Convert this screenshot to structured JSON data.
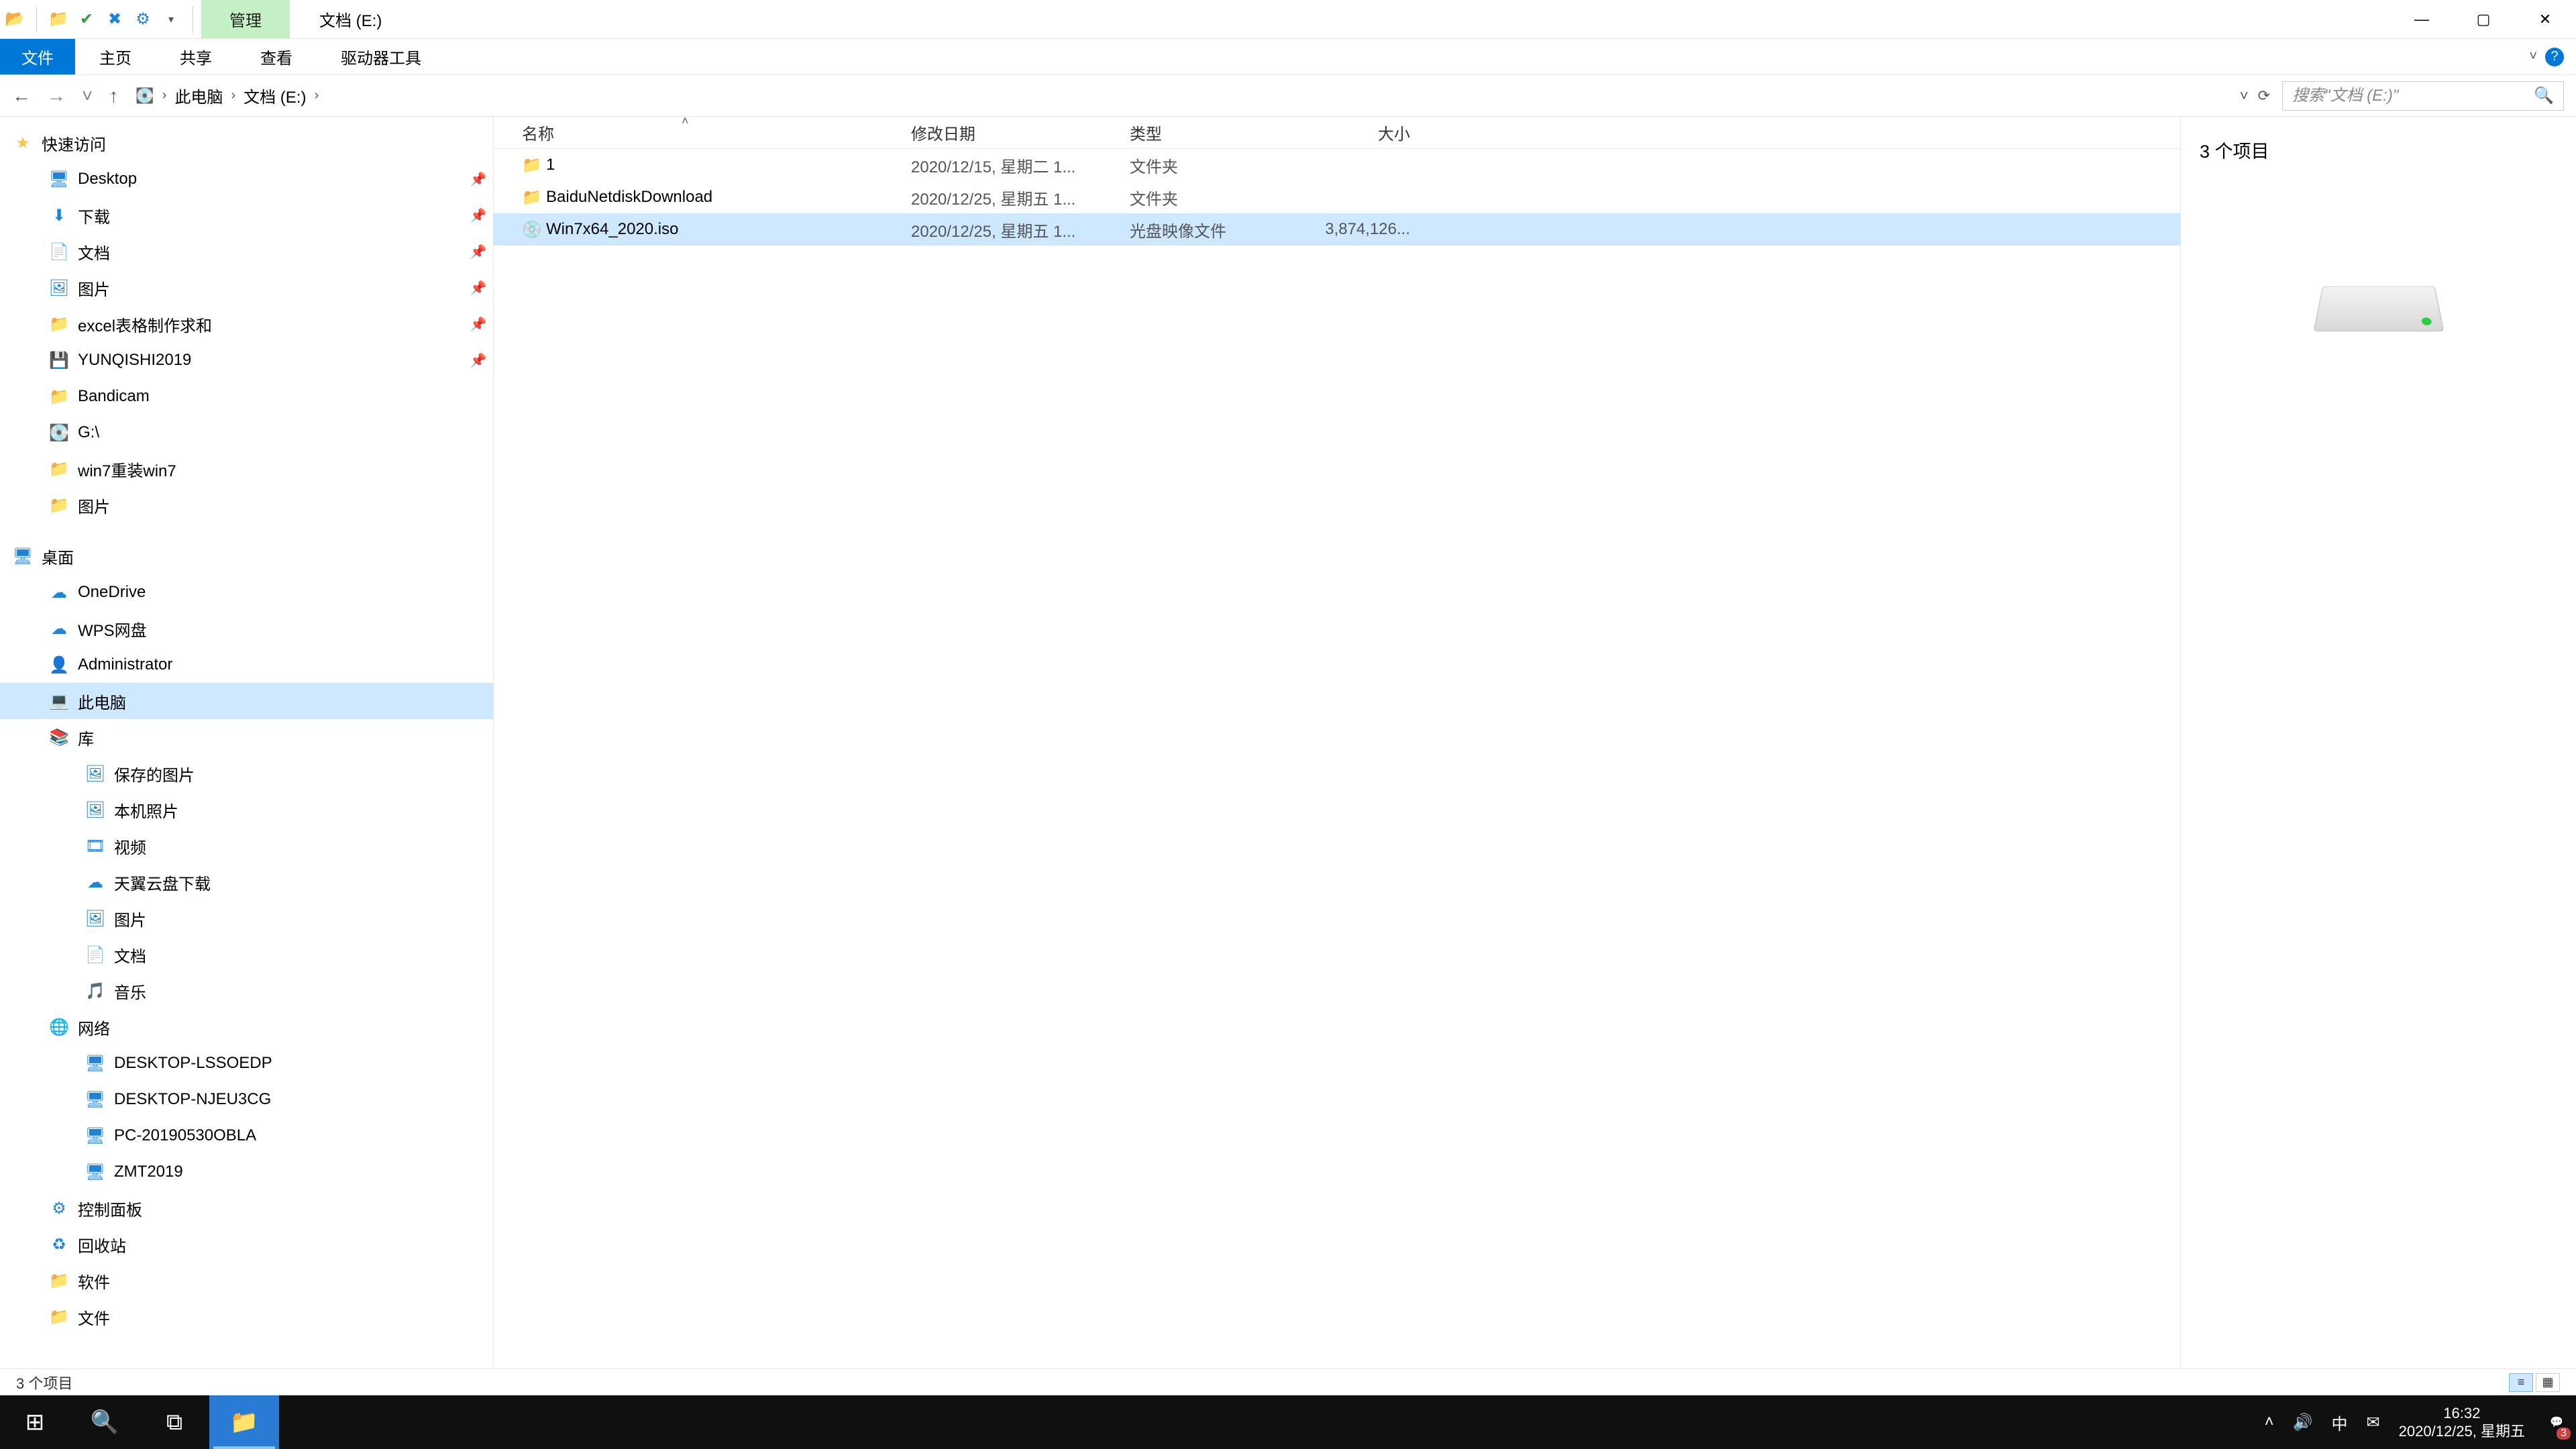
{
  "title": {
    "context_tab": "管理",
    "drive_label": "文档 (E:)"
  },
  "window_controls": {
    "min": "—",
    "max": "▢",
    "close": "✕"
  },
  "ribbon": {
    "file": "文件",
    "tabs": [
      "主页",
      "共享",
      "查看",
      "驱动器工具"
    ],
    "expand": "˅",
    "help": "?"
  },
  "nav": {
    "back": "←",
    "forward": "→",
    "recent": "˅",
    "up": "↑",
    "refresh": "⟳",
    "segments": [
      "此电脑",
      "文档 (E:)"
    ],
    "search_placeholder": "搜索\"文档 (E:)\"",
    "search_icon": "🔍"
  },
  "tree": {
    "quick_access": {
      "label": "快速访问",
      "items": [
        {
          "label": "Desktop",
          "icon": "🖥",
          "pinned": true,
          "cls": "blue-ico"
        },
        {
          "label": "下载",
          "icon": "⬇",
          "pinned": true,
          "cls": "blue-ico"
        },
        {
          "label": "文档",
          "icon": "📄",
          "pinned": true,
          "cls": "blue-ico"
        },
        {
          "label": "图片",
          "icon": "🖼",
          "pinned": true,
          "cls": "blue-ico"
        },
        {
          "label": "excel表格制作求和",
          "icon": "📁",
          "pinned": true,
          "cls": "folder-ico"
        },
        {
          "label": "YUNQISHI2019",
          "icon": "💾",
          "pinned": true,
          "cls": "blue-ico"
        },
        {
          "label": "Bandicam",
          "icon": "📁",
          "pinned": false,
          "cls": "folder-ico"
        },
        {
          "label": "G:\\",
          "icon": "💽",
          "pinned": false,
          "cls": "blue-ico"
        },
        {
          "label": "win7重装win7",
          "icon": "📁",
          "pinned": false,
          "cls": "folder-ico"
        },
        {
          "label": "图片",
          "icon": "📁",
          "pinned": false,
          "cls": "folder-ico"
        }
      ]
    },
    "desktop": {
      "label": "桌面",
      "items": [
        {
          "label": "OneDrive",
          "icon": "☁",
          "cls": "blue-ico"
        },
        {
          "label": "WPS网盘",
          "icon": "☁",
          "cls": "blue-ico"
        },
        {
          "label": "Administrator",
          "icon": "👤",
          "cls": "orange-ico"
        },
        {
          "label": "此电脑",
          "icon": "💻",
          "cls": "blue-ico",
          "selected": true
        },
        {
          "label": "库",
          "icon": "📚",
          "cls": "orange-ico"
        }
      ]
    },
    "libs": [
      {
        "label": "保存的图片",
        "icon": "🖼",
        "cls": "blue-ico"
      },
      {
        "label": "本机照片",
        "icon": "🖼",
        "cls": "blue-ico"
      },
      {
        "label": "视频",
        "icon": "🎞",
        "cls": "blue-ico"
      },
      {
        "label": "天翼云盘下载",
        "icon": "☁",
        "cls": "blue-ico"
      },
      {
        "label": "图片",
        "icon": "🖼",
        "cls": "blue-ico"
      },
      {
        "label": "文档",
        "icon": "📄",
        "cls": "blue-ico"
      },
      {
        "label": "音乐",
        "icon": "🎵",
        "cls": "blue-ico"
      }
    ],
    "network": {
      "label": "网络",
      "items": [
        {
          "label": "DESKTOP-LSSOEDP",
          "icon": "🖥",
          "cls": "blue-ico"
        },
        {
          "label": "DESKTOP-NJEU3CG",
          "icon": "🖥",
          "cls": "blue-ico"
        },
        {
          "label": "PC-20190530OBLA",
          "icon": "🖥",
          "cls": "blue-ico"
        },
        {
          "label": "ZMT2019",
          "icon": "🖥",
          "cls": "blue-ico"
        }
      ]
    },
    "extras": [
      {
        "label": "控制面板",
        "icon": "⚙",
        "cls": "blue-ico"
      },
      {
        "label": "回收站",
        "icon": "♻",
        "cls": "blue-ico"
      },
      {
        "label": "软件",
        "icon": "📁",
        "cls": "folder-ico"
      },
      {
        "label": "文件",
        "icon": "📁",
        "cls": "folder-ico"
      }
    ]
  },
  "columns": {
    "name": "名称",
    "date": "修改日期",
    "type": "类型",
    "size": "大小",
    "sort": "˄"
  },
  "files": [
    {
      "icon": "📁",
      "icls": "folder-ico",
      "name": "1",
      "date": "2020/12/15, 星期二 1...",
      "type": "文件夹",
      "size": ""
    },
    {
      "icon": "📁",
      "icls": "folder-ico",
      "name": "BaiduNetdiskDownload",
      "date": "2020/12/25, 星期五 1...",
      "type": "文件夹",
      "size": ""
    },
    {
      "icon": "💿",
      "icls": "file-ico",
      "name": "Win7x64_2020.iso",
      "date": "2020/12/25, 星期五 1...",
      "type": "光盘映像文件",
      "size": "3,874,126...",
      "selected": true
    }
  ],
  "preview": {
    "count_label": "3 个项目"
  },
  "status": {
    "text": "3 个项目"
  },
  "taskbar": {
    "items": [
      {
        "name": "start",
        "glyph": "⊞"
      },
      {
        "name": "search",
        "glyph": "🔍"
      },
      {
        "name": "taskview",
        "glyph": "⧉"
      },
      {
        "name": "explorer",
        "glyph": "📁",
        "active": true
      }
    ],
    "tray": {
      "up": "˄",
      "volume": "🔊",
      "ime": "中",
      "mail": "✉"
    },
    "clock": {
      "time": "16:32",
      "date": "2020/12/25, 星期五"
    },
    "notif": {
      "glyph": "💬",
      "badge": "3"
    }
  }
}
